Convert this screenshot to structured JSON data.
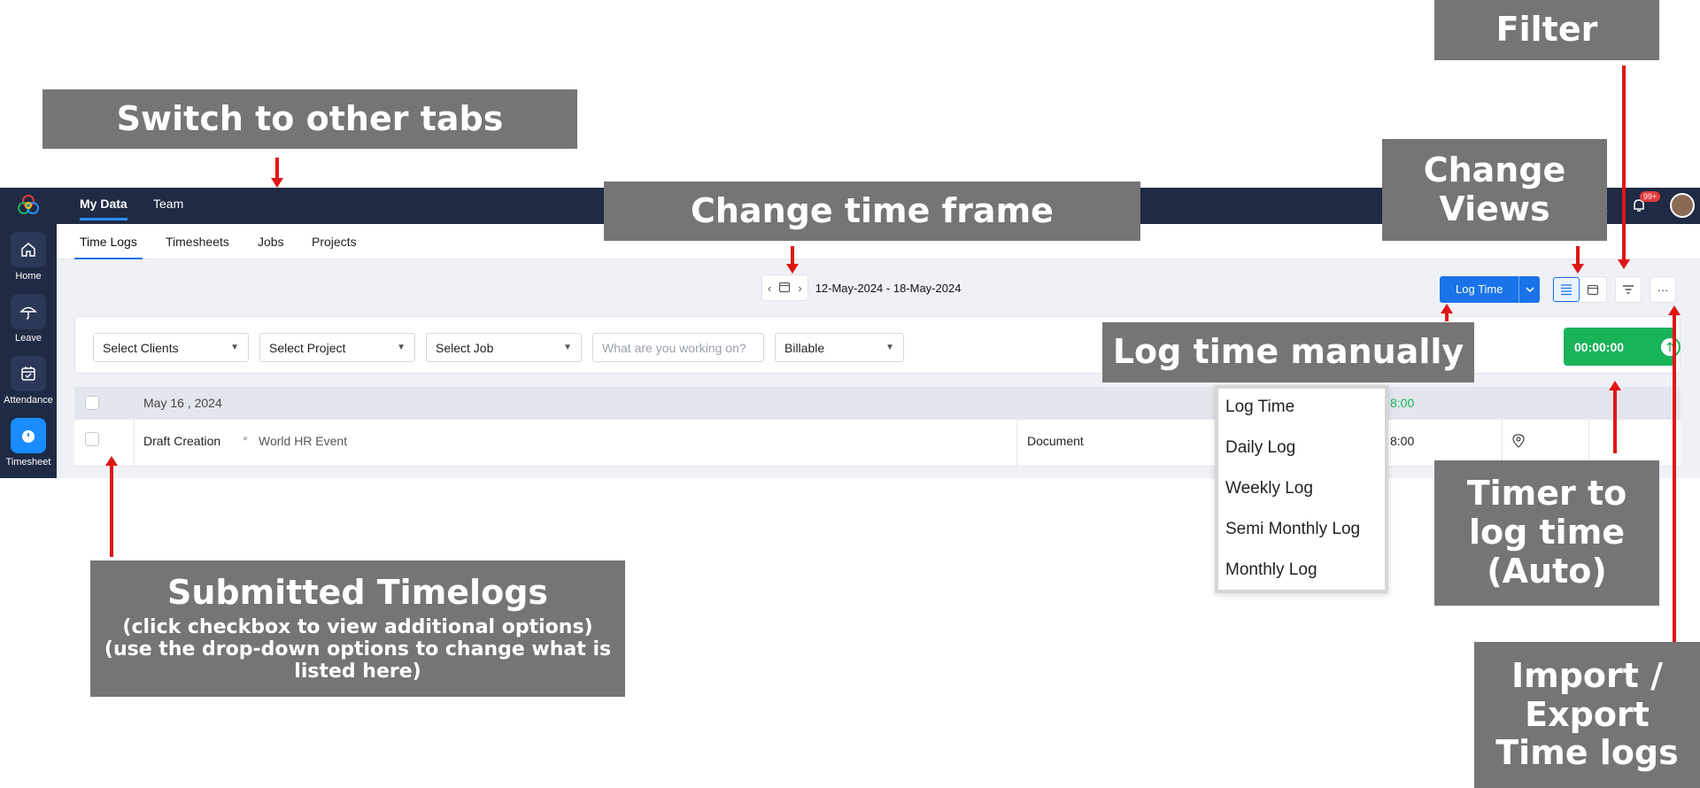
{
  "sidebar": {
    "items": [
      {
        "label": "Home",
        "icon": "home-icon"
      },
      {
        "label": "Leave",
        "icon": "umbrella-icon"
      },
      {
        "label": "Attendance",
        "icon": "calendar-check-icon"
      },
      {
        "label": "Timesheet",
        "icon": "timer-icon"
      }
    ]
  },
  "topbar": {
    "tabs": [
      {
        "label": "My Data"
      },
      {
        "label": "Team"
      }
    ],
    "notification_badge": "99+"
  },
  "subtabs": [
    {
      "label": "Time Logs"
    },
    {
      "label": "Timesheets"
    },
    {
      "label": "Jobs"
    },
    {
      "label": "Projects"
    }
  ],
  "toolbar": {
    "date_range": "12-May-2024 - 18-May-2024",
    "log_time_label": "Log Time",
    "more_label": "···"
  },
  "filters": {
    "clients": "Select Clients",
    "project": "Select Project",
    "job": "Select Job",
    "work_placeholder": "What are you working on?",
    "billable": "Billable",
    "timer": "00:00:00"
  },
  "log_group": {
    "date": "May 16 , 2024",
    "total": "8:00"
  },
  "log_entry": {
    "job": "Draft Creation",
    "project": "World HR Event",
    "type": "Document",
    "hours": "8:00"
  },
  "log_menu": {
    "items": [
      "Log Time",
      "Daily Log",
      "Weekly Log",
      "Semi Monthly Log",
      "Monthly Log"
    ]
  },
  "annotations": {
    "filter": "Filter",
    "switch_tabs": "Switch to other tabs",
    "change_time": "Change time frame",
    "change_views_1": "Change",
    "change_views_2": "Views",
    "log_manually": "Log time manually",
    "timer_1": "Timer to",
    "timer_2": "log time",
    "timer_3": "(Auto)",
    "submitted_title": "Submitted Timelogs",
    "submitted_line1": "(click checkbox to view additional options)",
    "submitted_line2": "(use the drop-down options to change what is",
    "submitted_line3": "listed here)",
    "import_1": "Import /",
    "import_2": "Export",
    "import_3": "Time logs"
  },
  "colors": {
    "nav_bg": "#1f2a44",
    "accent": "#1a73e8",
    "timer_green": "#19b35a",
    "annotation_gray": "#757575",
    "arrow_red": "#e01515"
  }
}
